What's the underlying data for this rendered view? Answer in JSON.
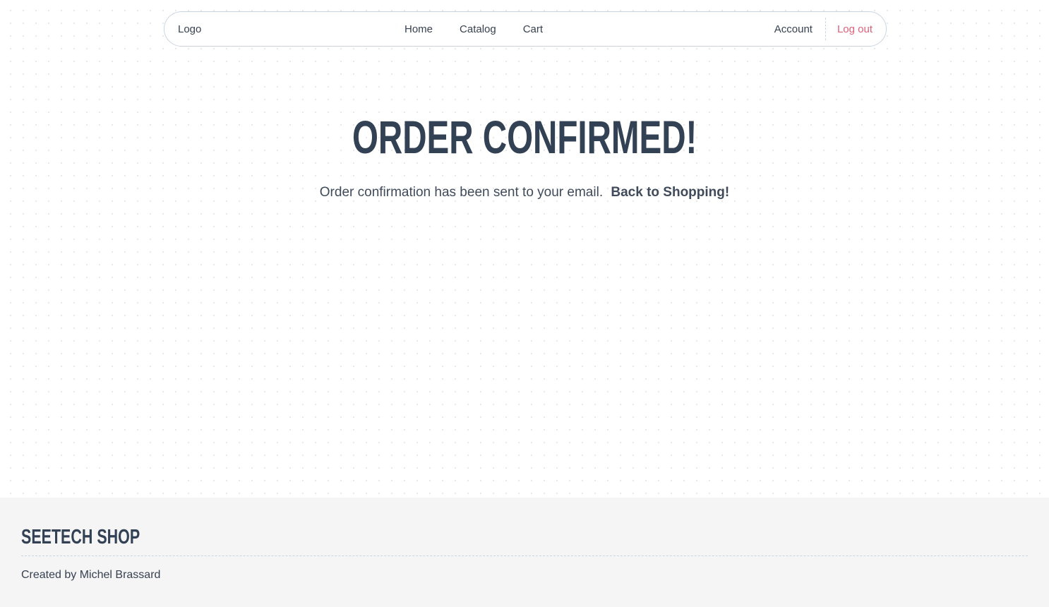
{
  "nav": {
    "logo": "Logo",
    "links": [
      "Home",
      "Catalog",
      "Cart"
    ],
    "account": "Account",
    "logout": "Log out"
  },
  "hero": {
    "title": "ORDER CONFIRMED!",
    "message": "Order confirmation has been sent to your email.",
    "link": "Back to Shopping!"
  },
  "footer": {
    "brand": "SEETECH SHOP",
    "credit": "Created by Michel Brassard"
  },
  "colors": {
    "text": "#334155",
    "logout": "#e0607a",
    "footer_bg": "#f5f5f5",
    "nav_border": "#cbd5e1"
  }
}
